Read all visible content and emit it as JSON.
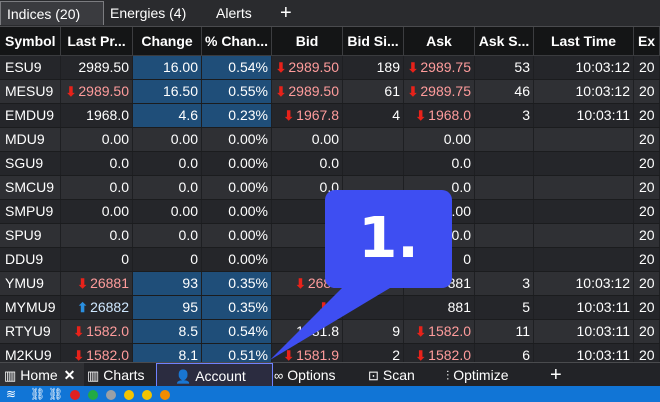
{
  "tabs": [
    {
      "label": "Indices (20)",
      "closable": true,
      "active": true
    },
    {
      "label": "Energies (4)",
      "closable": false,
      "active": false
    },
    {
      "label": "Alerts",
      "closable": false,
      "active": false
    }
  ],
  "add_tab_label": "+",
  "columns": [
    "Symbol",
    "Last Pr...",
    "Change",
    "% Chan...",
    "Bid",
    "Bid Si...",
    "Ask",
    "Ask S...",
    "Last Time",
    "Ex"
  ],
  "rows": [
    {
      "symbol": "ESU9",
      "last": "2989.50",
      "last_dir": "",
      "change": "16.00",
      "pct": "0.54%",
      "bid": "2989.50",
      "bid_dir": "down",
      "bid_size": "189",
      "ask": "2989.75",
      "ask_dir": "down",
      "ask_size": "53",
      "time": "10:03:12",
      "ex": "20"
    },
    {
      "symbol": "MESU9",
      "last": "2989.50",
      "last_dir": "down",
      "change": "16.50",
      "pct": "0.55%",
      "bid": "2989.50",
      "bid_dir": "down",
      "bid_size": "61",
      "ask": "2989.75",
      "ask_dir": "down",
      "ask_size": "46",
      "time": "10:03:12",
      "ex": "20"
    },
    {
      "symbol": "EMDU9",
      "last": "1968.0",
      "last_dir": "",
      "change": "4.6",
      "pct": "0.23%",
      "bid": "1967.8",
      "bid_dir": "down",
      "bid_size": "4",
      "ask": "1968.0",
      "ask_dir": "down",
      "ask_size": "3",
      "time": "10:03:11",
      "ex": "20"
    },
    {
      "symbol": "MDU9",
      "last": "0.00",
      "last_dir": "",
      "change": "0.00",
      "pct": "0.00%",
      "bid": "0.00",
      "bid_dir": "",
      "bid_size": "",
      "ask": "0.00",
      "ask_dir": "",
      "ask_size": "",
      "time": "",
      "ex": "20"
    },
    {
      "symbol": "SGU9",
      "last": "0.0",
      "last_dir": "",
      "change": "0.0",
      "pct": "0.00%",
      "bid": "0.0",
      "bid_dir": "",
      "bid_size": "",
      "ask": "0.0",
      "ask_dir": "",
      "ask_size": "",
      "time": "",
      "ex": "20"
    },
    {
      "symbol": "SMCU9",
      "last": "0.0",
      "last_dir": "",
      "change": "0.0",
      "pct": "0.00%",
      "bid": "0.0",
      "bid_dir": "",
      "bid_size": "",
      "ask": "0.0",
      "ask_dir": "",
      "ask_size": "",
      "time": "",
      "ex": "20"
    },
    {
      "symbol": "SMPU9",
      "last": "0.00",
      "last_dir": "",
      "change": "0.00",
      "pct": "0.00%",
      "bid": "0.",
      "bid_dir": "",
      "bid_size": "",
      "ask": "0.00",
      "ask_dir": "",
      "ask_size": "",
      "time": "",
      "ex": "20"
    },
    {
      "symbol": "SPU9",
      "last": "0.0",
      "last_dir": "",
      "change": "0.0",
      "pct": "0.00%",
      "bid": "0",
      "bid_dir": "",
      "bid_size": "",
      "ask": "0.0",
      "ask_dir": "",
      "ask_size": "",
      "time": "",
      "ex": "20"
    },
    {
      "symbol": "DDU9",
      "last": "0",
      "last_dir": "",
      "change": "0",
      "pct": "0.00%",
      "bid": "",
      "bid_dir": "",
      "bid_size": "",
      "ask": "0",
      "ask_dir": "",
      "ask_size": "",
      "time": "",
      "ex": "20"
    },
    {
      "symbol": "YMU9",
      "last": "26881",
      "last_dir": "down",
      "change": "93",
      "pct": "0.35%",
      "bid": "2688",
      "bid_dir": "down",
      "bid_size": "",
      "ask": "881",
      "ask_dir": "",
      "ask_size": "3",
      "time": "10:03:12",
      "ex": "20"
    },
    {
      "symbol": "MYMU9",
      "last": "26882",
      "last_dir": "up",
      "change": "95",
      "pct": "0.35%",
      "bid": "2",
      "bid_dir": "down",
      "bid_size": "",
      "ask": "881",
      "ask_dir": "",
      "ask_size": "5",
      "time": "10:03:11",
      "ex": "20"
    },
    {
      "symbol": "RTYU9",
      "last": "1582.0",
      "last_dir": "down",
      "change": "8.5",
      "pct": "0.54%",
      "bid": "1581.8",
      "bid_dir": "",
      "bid_size": "9",
      "ask": "1582.0",
      "ask_dir": "down",
      "ask_size": "11",
      "time": "10:03:11",
      "ex": "20"
    },
    {
      "symbol": "M2KU9",
      "last": "1582.0",
      "last_dir": "down",
      "change": "8.1",
      "pct": "0.51%",
      "bid": "1581.9",
      "bid_dir": "down",
      "bid_size": "2",
      "ask": "1582.0",
      "ask_dir": "down",
      "ask_size": "6",
      "time": "10:03:11",
      "ex": "20"
    }
  ],
  "bottom_tabs": [
    {
      "label": "Home",
      "icon": "bar-chart-icon",
      "closable": true
    },
    {
      "label": "Charts",
      "icon": "bar-chart-icon",
      "closable": false
    },
    {
      "label": "Account",
      "icon": "user-icon",
      "closable": false
    },
    {
      "label": "Options",
      "icon": "link-icon",
      "closable": false
    },
    {
      "label": "Scan",
      "icon": "scan-icon",
      "closable": false
    },
    {
      "label": "Optimize",
      "icon": "sliders-icon",
      "closable": false
    }
  ],
  "bottom_add_label": "+",
  "callout_label": "1.",
  "status_dots": [
    "#e02020",
    "#22aa44",
    "#9aa0a6",
    "#f2c400",
    "#f2c400",
    "#f28c00"
  ],
  "colors": {
    "highlight": "#1f4e79",
    "accent": "#3e4ef2",
    "status_bar": "#1175d6"
  }
}
